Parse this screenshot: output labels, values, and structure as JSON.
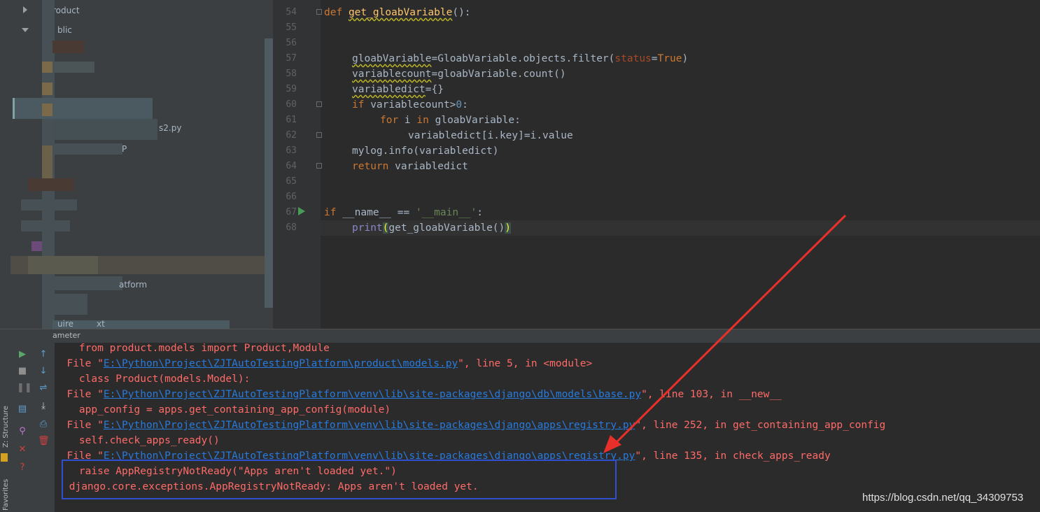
{
  "project": {
    "items": [
      "roduct",
      "blic",
      "s2.py",
      "P",
      "atform",
      "uire",
      "xt"
    ]
  },
  "editor": {
    "line_numbers": [
      "54",
      "55",
      "56",
      "57",
      "58",
      "59",
      "60",
      "61",
      "62",
      "63",
      "64",
      "65",
      "66",
      "67",
      "68"
    ],
    "code": {
      "l54": {
        "kw": "def",
        "fn": "get_gloabVariable",
        "rest": "():"
      },
      "l57": {
        "var": "gloabVariable",
        "eq": "=GloabVariable.objects.filter(",
        "param": "status",
        "eq2": "=",
        "kwval": "True",
        "end": ")"
      },
      "l58": {
        "var": "variablecount",
        "rest": "=gloabVariable.count()"
      },
      "l59": {
        "var": "variabledict",
        "rest": "={}"
      },
      "l60": {
        "kw": "if",
        "rest": " variablecount>",
        "num": "0",
        "end": ":"
      },
      "l61": {
        "kw": "for",
        "mid": " i ",
        "kw2": "in",
        "rest": " gloabVariable:"
      },
      "l62": {
        "text": "variabledict[i.key]=i.value"
      },
      "l63": {
        "text": "mylog.info(variabledict)"
      },
      "l64": {
        "kw": "return",
        "rest": " variabledict"
      },
      "l67": {
        "kw": "if",
        "mid": " __name__ == ",
        "str": "'__main__'",
        "end": ":"
      },
      "l68": {
        "bi": "print",
        "open": "(",
        "call": "get_gloabVariable()",
        "close": ")"
      }
    }
  },
  "run": {
    "tab_label": "ameter",
    "vertical_tabs": {
      "structure": "Z: Structure",
      "favorites": "Favorites"
    }
  },
  "console": {
    "lines": {
      "c1": "    from product.models import Product,Module",
      "c2_pre": "  File \"",
      "c2_link": "E:\\Python\\Project\\ZJTAutoTestingPlatform\\product\\models.py",
      "c2_post": "\", line 5, in <module>",
      "c3": "    class Product(models.Model):",
      "c4_pre": "  File \"",
      "c4_link": "E:\\Python\\Project\\ZJTAutoTestingPlatform\\venv\\lib\\site-packages\\django\\db\\models\\base.py",
      "c4_post": "\", line 103, in __new__",
      "c5": "    app_config = apps.get_containing_app_config(module)",
      "c6_pre": "  File \"",
      "c6_link": "E:\\Python\\Project\\ZJTAutoTestingPlatform\\venv\\lib\\site-packages\\django\\apps\\registry.py",
      "c6_post": "\", line 252, in get_containing_app_config",
      "c7": "    self.check_apps_ready()",
      "c8_pre": "  File \"",
      "c8_link": "E:\\Python\\Project\\ZJTAutoTestingPlatform\\venv\\lib\\site-packages\\django\\apps\\registry.py",
      "c8_post": "\", line 135, in check_apps_ready",
      "c9": "    raise AppRegistryNotReady(\"Apps aren't loaded yet.\")",
      "c10": " django.core.exceptions.AppRegistryNotReady: Apps aren't loaded yet."
    }
  },
  "watermark": "https://blog.csdn.net/qq_34309753",
  "colors": {
    "error": "#ff6b68",
    "link": "#287bde",
    "keyword": "#cc7832",
    "function": "#ffc66d",
    "annotation_box": "#3050d0",
    "annotation_arrow": "#e8302a"
  }
}
